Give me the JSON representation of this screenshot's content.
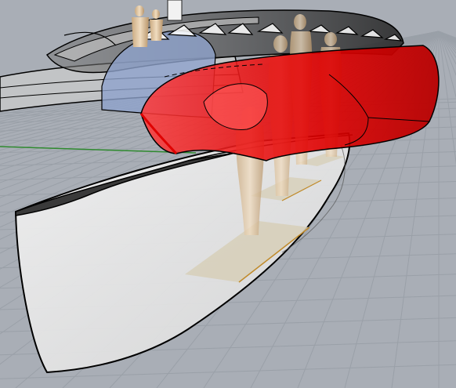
{
  "viewport": {
    "display_mode": "ghosted-shaded-perspective",
    "colors": {
      "background": "#a9aeb6",
      "grid_line": "#9aa0a8",
      "x_axis": "#2f8a2f",
      "selection": "#e00000",
      "hull": "#e6e6e6",
      "deck": "#3a3a3a",
      "glass": "#8fa3cc",
      "figure": "#d9c3a3",
      "floor_panel": "#d7cfb9",
      "floor_edge": "#c08a2a"
    }
  }
}
